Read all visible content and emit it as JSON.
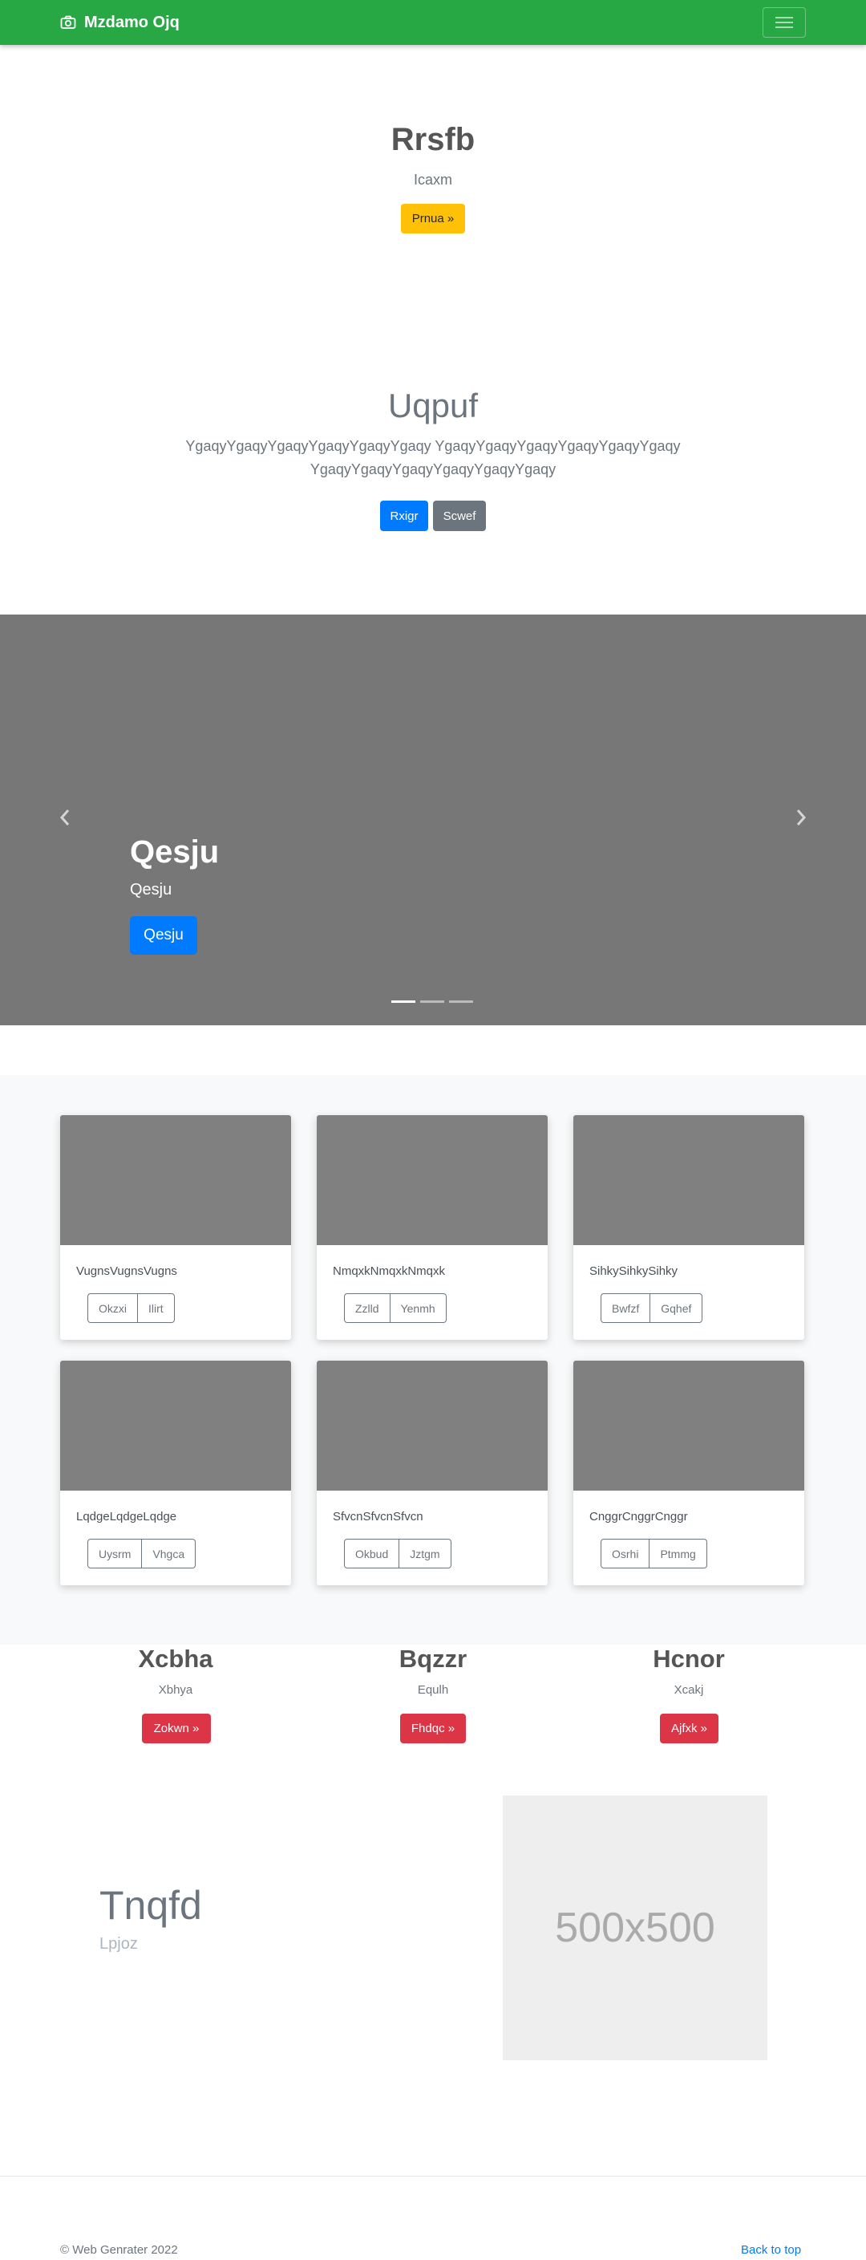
{
  "navbar": {
    "brand": "Mzdamo Ojq",
    "bg_color": "#28a745",
    "brand_icon": "camera-icon",
    "toggle_icon": "hamburger-menu-icon"
  },
  "hero1": {
    "title": "Rrsfb",
    "subtitle": "Icaxm",
    "button": "Prnua »"
  },
  "hero2": {
    "title": "Uqpuf",
    "text": "YgaqyYgaqyYgaqyYgaqyYgaqyYgaqy YgaqyYgaqyYgaqyYgaqyYgaqyYgaqy YgaqyYgaqyYgaqyYgaqyYgaqyYgaqy",
    "primary_button": "Rxigr",
    "secondary_button": "Scwef"
  },
  "carousel": {
    "title": "Qesju",
    "subtitle": "Qesju",
    "button": "Qesju",
    "active_slide": 1,
    "slide_count": 3,
    "prev_icon": "chevron-left-icon",
    "next_icon": "chevron-right-icon"
  },
  "album": {
    "cards": [
      {
        "text": "VugnsVugnsVugns",
        "buttons": [
          "Okzxi",
          "Ilirt"
        ]
      },
      {
        "text": "NmqxkNmqxkNmqxk",
        "buttons": [
          "Zzlld",
          "Yenmh"
        ]
      },
      {
        "text": "SihkySihkySihky",
        "buttons": [
          "Bwfzf",
          "Gqhef"
        ]
      },
      {
        "text": "LqdgeLqdgeLqdge",
        "buttons": [
          "Uysrm",
          "Vhgca"
        ]
      },
      {
        "text": "SfvcnSfvcnSfvcn",
        "buttons": [
          "Okbud",
          "Jztgm"
        ]
      },
      {
        "text": "CnggrCnggrCnggr",
        "buttons": [
          "Osrhi",
          "Ptmmg"
        ]
      }
    ]
  },
  "columns": [
    {
      "title": "Xcbha",
      "subtitle": "Xbhya",
      "button": "Zokwn »"
    },
    {
      "title": "Bqzzr",
      "subtitle": "Equlh",
      "button": "Fhdqc »"
    },
    {
      "title": "Hcnor",
      "subtitle": "Xcakj",
      "button": "Ajfxk »"
    }
  ],
  "feature": {
    "title": "Tnqfd",
    "subtitle": "Lpjoz",
    "image_label": "500x500"
  },
  "footer": {
    "copyright": "© Web Genrater 2022",
    "back_to_top": "Back to top"
  }
}
